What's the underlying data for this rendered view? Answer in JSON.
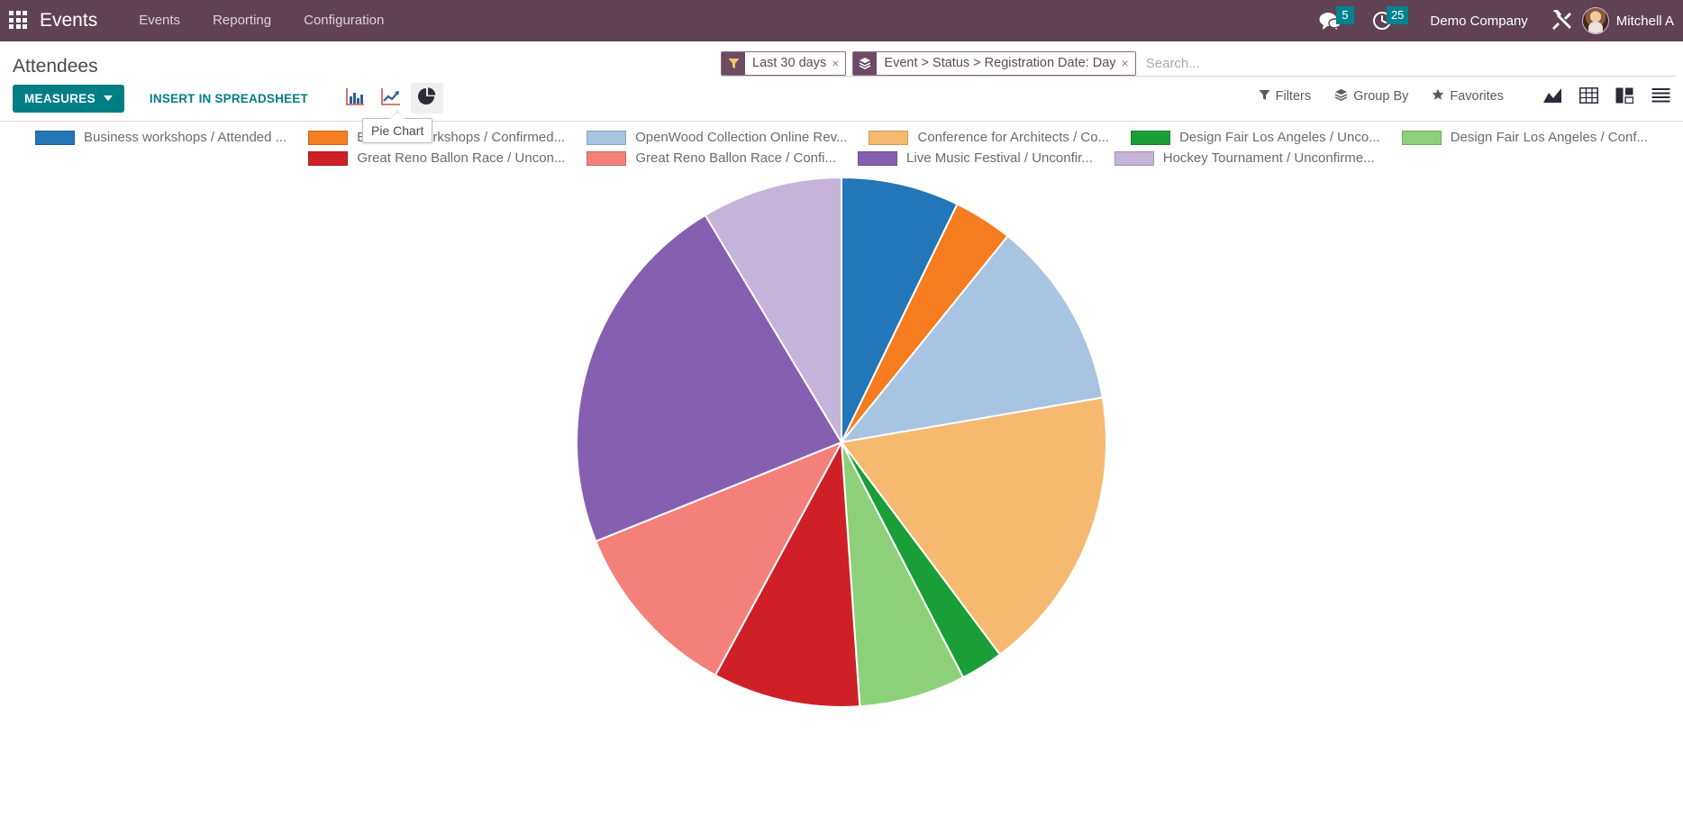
{
  "navbar": {
    "apps_icon": "apps-grid-icon",
    "brand": "Events",
    "menu": [
      {
        "label": "Events"
      },
      {
        "label": "Reporting"
      },
      {
        "label": "Configuration"
      }
    ],
    "messages_icon": "messages-icon",
    "messages_count": "5",
    "activities_icon": "clock-icon",
    "activities_count": "25",
    "company": "Demo Company",
    "tools_icon": "wrench-icon",
    "avatar_icon": "user-avatar",
    "user": "Mitchell A"
  },
  "control_panel": {
    "title": "Attendees",
    "measures_label": "MEASURES",
    "insert_spreadsheet_label": "INSERT IN SPREADSHEET",
    "chart_types": [
      {
        "name": "bar-chart-icon",
        "label": "Bar Chart",
        "active": false
      },
      {
        "name": "line-chart-icon",
        "label": "Line Chart",
        "active": false
      },
      {
        "name": "pie-chart-icon",
        "label": "Pie Chart",
        "active": true
      }
    ],
    "tooltip": "Pie Chart",
    "filters_label": "Filters",
    "groupby_label": "Group By",
    "favorites_label": "Favorites",
    "view_types": [
      {
        "name": "graph-view-icon",
        "active": true
      },
      {
        "name": "pivot-view-icon",
        "active": false
      },
      {
        "name": "kanban-view-icon",
        "active": false
      },
      {
        "name": "list-view-icon",
        "active": false
      }
    ]
  },
  "search": {
    "facets": [
      {
        "icon": "filter-icon",
        "label": "Last 30 days",
        "remove": "×"
      },
      {
        "icon": "groupby-layers-icon",
        "label": "Event > Status > Registration Date: Day",
        "remove": "×"
      }
    ],
    "placeholder": "Search...",
    "value": ""
  },
  "chart_data": {
    "type": "pie",
    "title": "Attendees",
    "legend_position": "top",
    "labels": [
      "Business workshops / Attended ...",
      "Business workshops / Confirmed...",
      "OpenWood Collection Online Rev...",
      "Conference for Architects / Co...",
      "Design Fair Los Angeles / Unco...",
      "Design Fair Los Angeles / Conf...",
      "Great Reno Ballon Race / Uncon...",
      "Great Reno Ballon Race / Confi...",
      "Live Music Festival / Unconfir...",
      "Hockey Tournament / Unconfirme..."
    ],
    "colors": [
      "#2376b8",
      "#f57c1f",
      "#a8c4e3",
      "#f5b970",
      "#1a9e38",
      "#8dd07a",
      "#cf2027",
      "#f4807a",
      "#8560b0",
      "#c5b3da"
    ],
    "values": [
      7.2,
      3.6,
      11.5,
      17.5,
      2.6,
      6.5,
      9.0,
      11.0,
      22.5,
      8.6
    ],
    "unit": "%"
  }
}
